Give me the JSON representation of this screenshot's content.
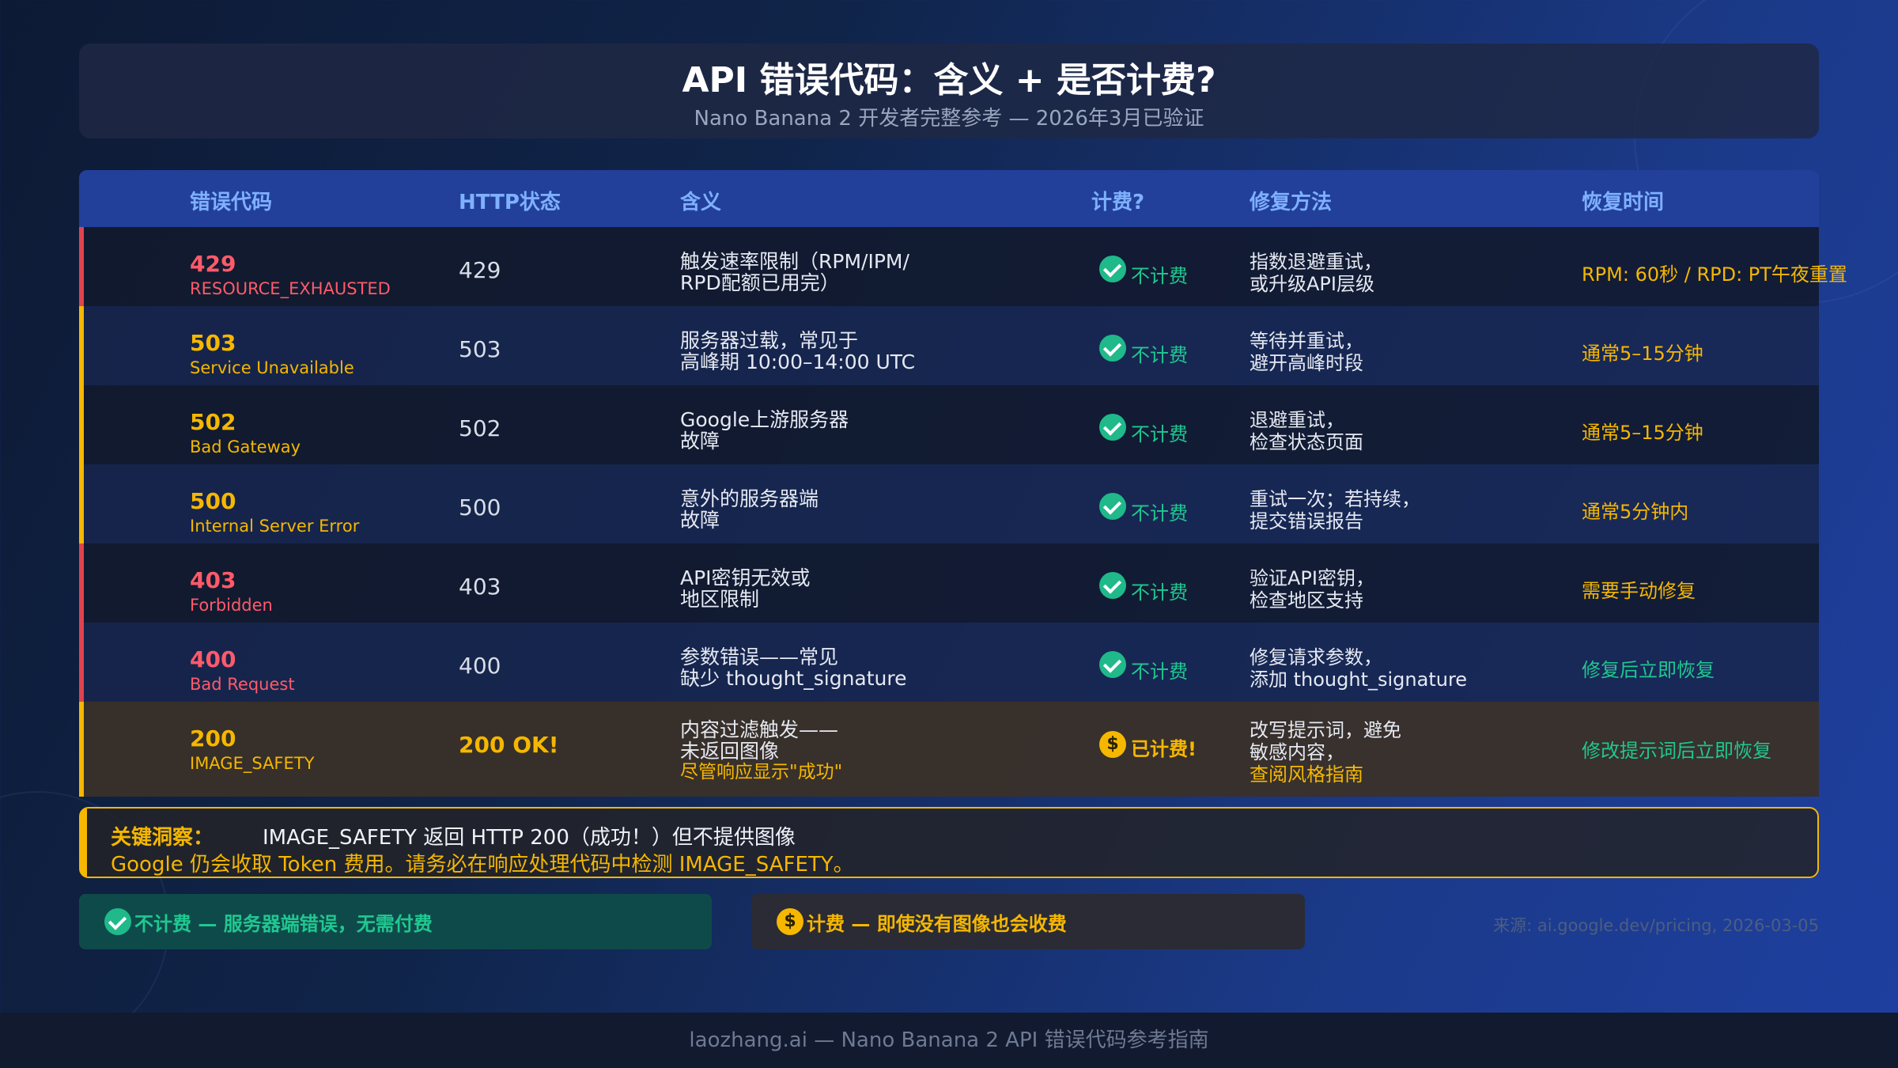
{
  "header": {
    "title": "API 错误代码：含义 + 是否计费?",
    "subtitle": "Nano Banana 2 开发者完整参考 — 2026年3月已验证"
  },
  "table": {
    "columns": [
      "错误代码",
      "HTTP状态",
      "含义",
      "计费?",
      "修复方法",
      "恢复时间"
    ],
    "rows": [
      {
        "code": "429",
        "name": "RESOURCE_EXHAUSTED",
        "http": "429",
        "meaning_1": "触发速率限制（RPM/IPM/",
        "meaning_2": "RPD配额已用完）",
        "billing": "不计费",
        "billing_icon": "check-icon",
        "fix_1": "指数退避重试，",
        "fix_2": "或升级API层级",
        "recovery": "RPM: 60秒 / RPD: PT午夜重置",
        "accent": "#e0434f",
        "code_color": "#ff5a6a",
        "recovery_color": "#f5b700"
      },
      {
        "code": "503",
        "name": "Service Unavailable",
        "http": "503",
        "meaning_1": "服务器过载，常见于",
        "meaning_2": "高峰期 10:00–14:00 UTC",
        "billing": "不计费",
        "billing_icon": "check-icon",
        "fix_1": "等待并重试，",
        "fix_2": "避开高峰时段",
        "recovery": "通常5–15分钟",
        "accent": "#f5b700",
        "code_color": "#f5b700",
        "recovery_color": "#f5b700"
      },
      {
        "code": "502",
        "name": "Bad Gateway",
        "http": "502",
        "meaning_1": "Google上游服务器",
        "meaning_2": "故障",
        "billing": "不计费",
        "billing_icon": "check-icon",
        "fix_1": "退避重试，",
        "fix_2": "检查状态页面",
        "recovery": "通常5–15分钟",
        "accent": "#f5b700",
        "code_color": "#f5b700",
        "recovery_color": "#f5b700"
      },
      {
        "code": "500",
        "name": "Internal Server Error",
        "http": "500",
        "meaning_1": "意外的服务器端",
        "meaning_2": "故障",
        "billing": "不计费",
        "billing_icon": "check-icon",
        "fix_1": "重试一次；若持续，",
        "fix_2": "提交错误报告",
        "recovery": "通常5分钟内",
        "accent": "#f5b700",
        "code_color": "#f5b700",
        "recovery_color": "#f5b700"
      },
      {
        "code": "403",
        "name": "Forbidden",
        "http": "403",
        "meaning_1": "API密钥无效或",
        "meaning_2": "地区限制",
        "billing": "不计费",
        "billing_icon": "check-icon",
        "fix_1": "验证API密钥，",
        "fix_2": "检查地区支持",
        "recovery": "需要手动修复",
        "accent": "#e0434f",
        "code_color": "#ff5a6a",
        "recovery_color": "#f5b700"
      },
      {
        "code": "400",
        "name": "Bad Request",
        "http": "400",
        "meaning_1": "参数错误——常见",
        "meaning_2": "缺少 thought_signature",
        "billing": "不计费",
        "billing_icon": "check-icon",
        "fix_1": "修复请求参数，",
        "fix_2": "添加 thought_signature",
        "recovery": "修复后立即恢复",
        "accent": "#e0434f",
        "code_color": "#ff5a6a",
        "recovery_color": "#1fc890"
      },
      {
        "code": "200",
        "name": "IMAGE_SAFETY",
        "http": "200 OK!",
        "meaning_1": "内容过滤触发——",
        "meaning_2": "未返回图像",
        "meaning_3": "尽管响应显示\"成功\"",
        "billing": "已计费!",
        "billing_icon": "dollar-icon",
        "fix_1": "改写提示词，避免",
        "fix_2": "敏感内容，",
        "fix_3": "查阅风格指南",
        "recovery": "修改提示词后立即恢复",
        "accent": "#f5b700",
        "code_color": "#f5b700",
        "recovery_color": "#1fc890"
      }
    ]
  },
  "insight": {
    "label": "关键洞察：",
    "line1": "IMAGE_SAFETY 返回 HTTP 200（成功！）但不提供图像",
    "line2": "Google 仍会收取 Token 费用。请务必在响应处理代码中检测 IMAGE_SAFETY。"
  },
  "legend": {
    "free": "不计费 — 服务器端错误，无需付费",
    "paid": "计费 — 即使没有图像也会收费",
    "dollar": "$"
  },
  "source": "来源: ai.google.dev/pricing, 2026-03-05",
  "footer": "laozhang.ai — Nano Banana 2 API 错误代码参考指南"
}
